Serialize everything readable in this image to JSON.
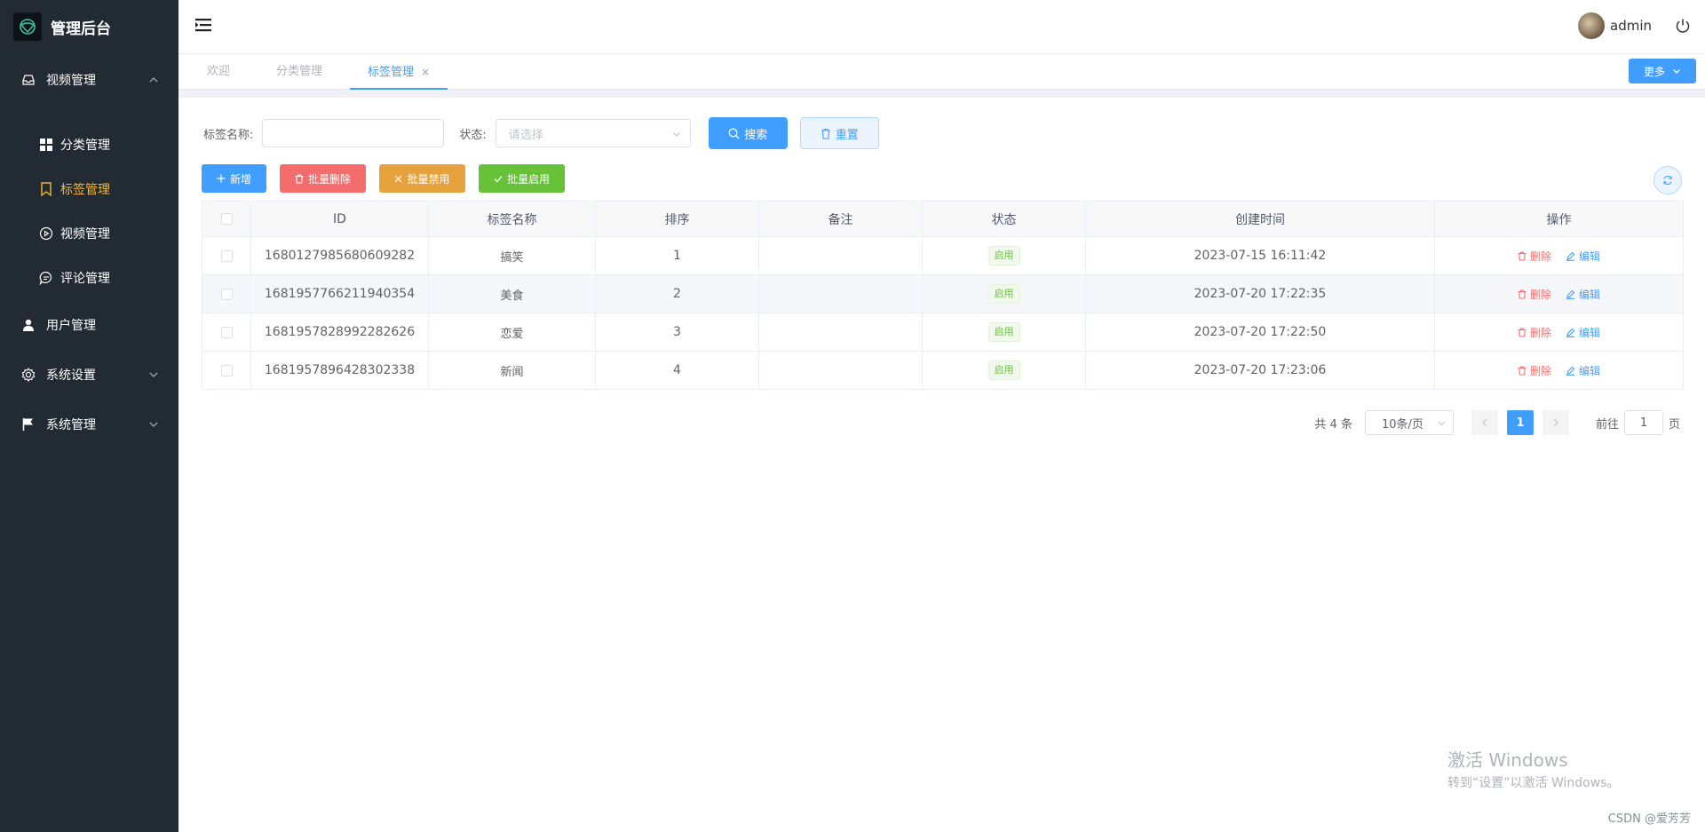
{
  "brand": {
    "title": "管理后台"
  },
  "sidebar": {
    "video_group": "视频管理",
    "sub_items": [
      {
        "label": "分类管理"
      },
      {
        "label": "标签管理"
      },
      {
        "label": "视频管理"
      },
      {
        "label": "评论管理"
      }
    ],
    "user_mgmt": "用户管理",
    "system_settings": "系统设置",
    "system_mgmt": "系统管理"
  },
  "header": {
    "username": "admin"
  },
  "tabs": [
    {
      "label": "欢迎"
    },
    {
      "label": "分类管理"
    },
    {
      "label": "标签管理",
      "close": "×"
    }
  ],
  "more_button": "更多",
  "search": {
    "name_label": "标签名称:",
    "status_label": "状态:",
    "status_placeholder": "请选择",
    "search_button": "搜索",
    "reset_button": "重置"
  },
  "actions": {
    "add": "新增",
    "batch_delete": "批量删除",
    "batch_disable": "批量禁用",
    "batch_enable": "批量启用"
  },
  "table": {
    "columns": [
      "ID",
      "标签名称",
      "排序",
      "备注",
      "状态",
      "创建时间",
      "操作"
    ],
    "rows": [
      {
        "id": "1680127985680609282",
        "name": "搞笑",
        "order": "1",
        "remark": "",
        "status": "启用",
        "created": "2023-07-15 16:11:42",
        "del": "删除",
        "edit": "编辑"
      },
      {
        "id": "1681957766211940354",
        "name": "美食",
        "order": "2",
        "remark": "",
        "status": "启用",
        "created": "2023-07-20 17:22:35",
        "del": "删除",
        "edit": "编辑"
      },
      {
        "id": "1681957828992282626",
        "name": "恋爱",
        "order": "3",
        "remark": "",
        "status": "启用",
        "created": "2023-07-20 17:22:50",
        "del": "删除",
        "edit": "编辑"
      },
      {
        "id": "1681957896428302338",
        "name": "新闻",
        "order": "4",
        "remark": "",
        "status": "启用",
        "created": "2023-07-20 17:23:06",
        "del": "删除",
        "edit": "编辑"
      }
    ]
  },
  "pagination": {
    "total": "共 4 条",
    "page_size": "10条/页",
    "current_page": "1",
    "goto_prefix": "前往",
    "goto_value": "1",
    "goto_suffix": "页"
  },
  "watermark": {
    "line1": "激活 Windows",
    "line2": "转到“设置”以激活 Windows。"
  },
  "footer_credit": "CSDN @爱芳芳",
  "colors": {
    "sidebar_bg": "#222a33",
    "primary": "#409eff",
    "danger": "#f56c6c",
    "warning": "#e6a23c",
    "success": "#67c23a",
    "active_menu": "#f5b82e"
  }
}
